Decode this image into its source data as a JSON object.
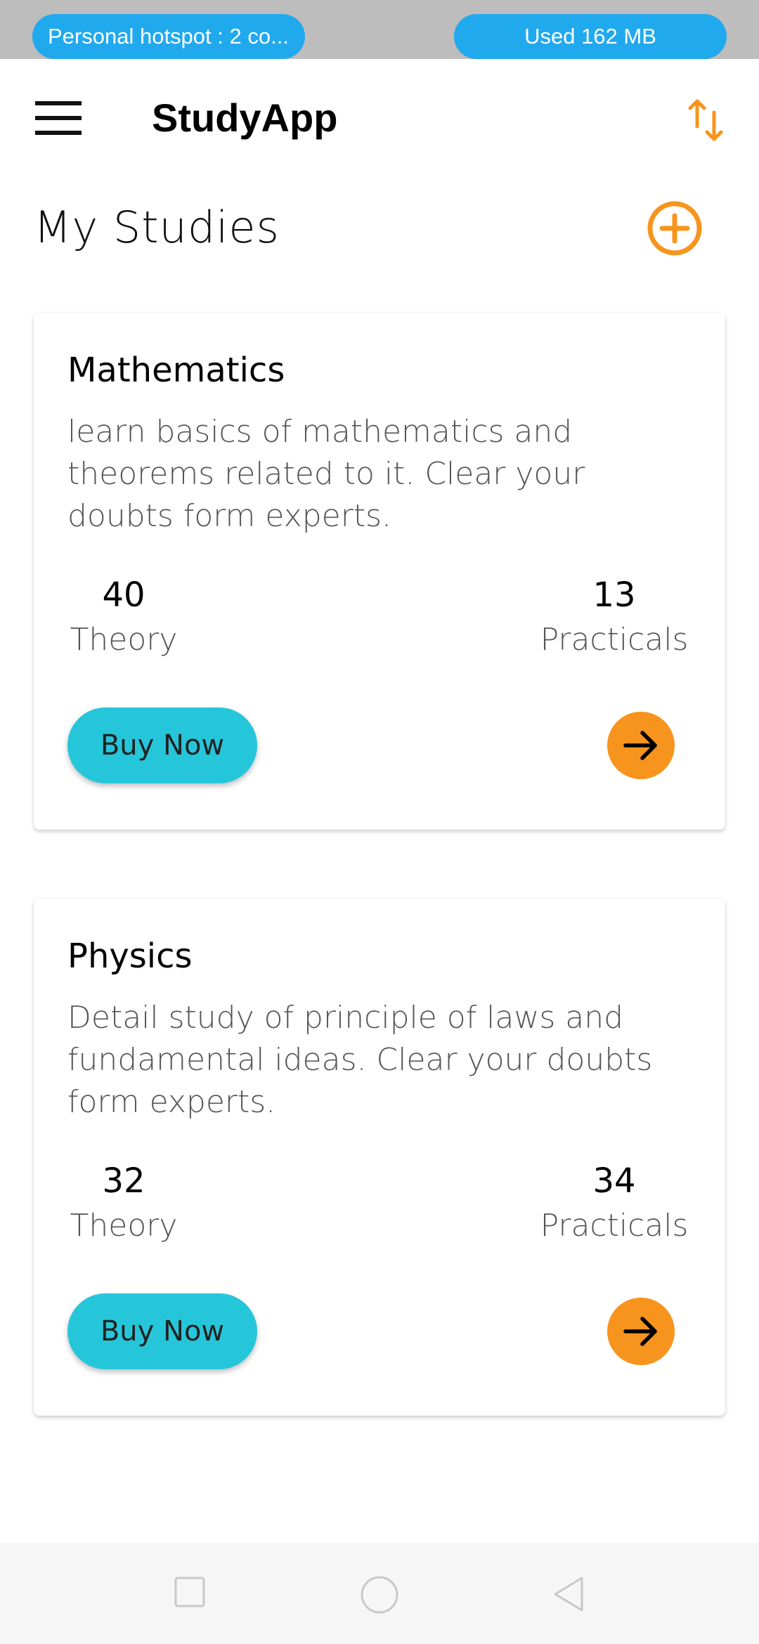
{
  "status_bar": {
    "hotspot_text": "Personal hotspot : 2 co...",
    "usage_text": "Used  162 MB"
  },
  "app_bar": {
    "menu_icon": "hamburger-menu-icon",
    "title": "StudyApp",
    "sort_icon": "sort-arrows-icon"
  },
  "section": {
    "title": "My Studies",
    "add_icon": "add-circle-icon"
  },
  "studies": [
    {
      "title": "Mathematics",
      "description": "learn basics of mathematics and theorems related to it. Clear your doubts form experts.",
      "theory_count": "40",
      "theory_label": "Theory",
      "practicals_count": "13",
      "practicals_label": "Practicals",
      "buy_label": "Buy Now"
    },
    {
      "title": "Physics",
      "description": "Detail study of principle of laws and fundamental ideas. Clear your doubts form experts.",
      "theory_count": "32",
      "theory_label": "Theory",
      "practicals_count": "34",
      "practicals_label": "Practicals",
      "buy_label": "Buy Now"
    }
  ],
  "colors": {
    "accent_orange": "#f7941d",
    "button_teal": "#26c6da",
    "status_pill_blue": "#21a9ee"
  }
}
